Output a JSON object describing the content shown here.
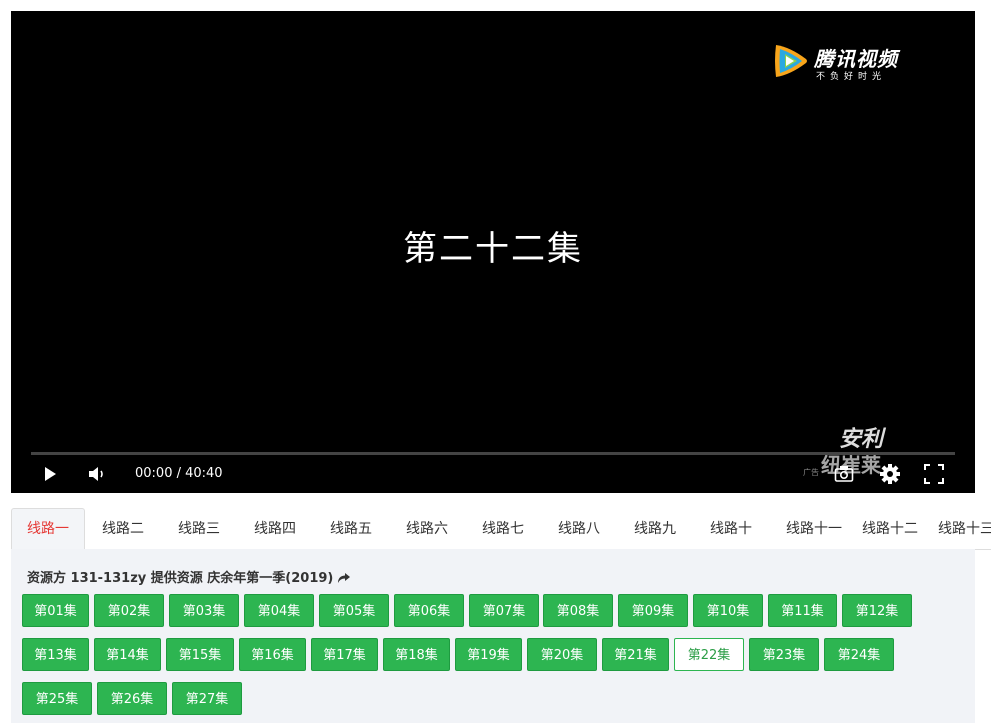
{
  "player": {
    "logo_name": "腾讯视频",
    "logo_slogan": "不负好时光",
    "episode_title": "第二十二集",
    "watermark_line1": "安利",
    "watermark_line2": "纽崔莱",
    "ad_label": "广告",
    "time": "00:00 / 40:40",
    "progress": 0,
    "icons": [
      "play-icon",
      "volume-icon",
      "screenshot-icon",
      "settings-icon",
      "fullscreen-icon"
    ]
  },
  "tabs": [
    "线路一",
    "线路二",
    "线路三",
    "线路四",
    "线路五",
    "线路六",
    "线路七",
    "线路八",
    "线路九",
    "线路十",
    "线路十一",
    "线路十二",
    "线路十三"
  ],
  "active_tab": 0,
  "source_text": "资源方 131-131zy 提供资源 庆余年第一季(2019)",
  "episodes": [
    "第01集",
    "第02集",
    "第03集",
    "第04集",
    "第05集",
    "第06集",
    "第07集",
    "第08集",
    "第09集",
    "第10集",
    "第11集",
    "第12集",
    "第13集",
    "第14集",
    "第15集",
    "第16集",
    "第17集",
    "第18集",
    "第19集",
    "第20集",
    "第21集",
    "第22集",
    "第23集",
    "第24集",
    "第25集",
    "第26集",
    "第27集"
  ],
  "current_episode": "第22集",
  "colors": {
    "accent_green": "#2db551",
    "active_tab_red": "#e53935"
  }
}
